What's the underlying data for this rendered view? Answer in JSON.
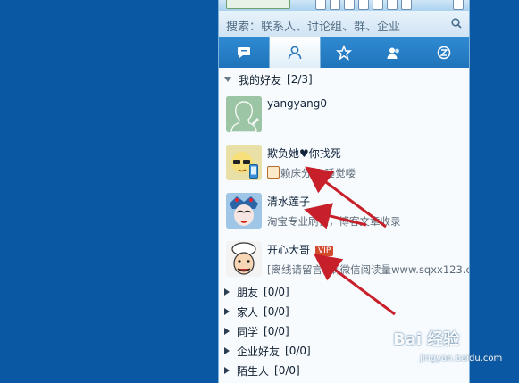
{
  "search": {
    "placeholder": "搜索：联系人、讨论组、群、企业"
  },
  "tabs": [
    {
      "name": "recent-chats",
      "icon": "chat-bubble-icon"
    },
    {
      "name": "contacts",
      "icon": "person-icon",
      "active": true
    },
    {
      "name": "favorites",
      "icon": "star-icon"
    },
    {
      "name": "groups",
      "icon": "group-icon"
    },
    {
      "name": "discover",
      "icon": "qzone-icon"
    }
  ],
  "groups": {
    "my_friends": {
      "label": "我的好友",
      "count": "[2/3]"
    },
    "friends": {
      "label": "朋友",
      "count": "[0/0]"
    },
    "family": {
      "label": "家人",
      "count": "[0/0]"
    },
    "classmates": {
      "label": "同学",
      "count": "[0/0]"
    },
    "enterprise": {
      "label": "企业好友",
      "count": "[0/0]"
    },
    "strangers": {
      "label": "陌生人",
      "count": "[0/0]"
    }
  },
  "contacts": [
    {
      "name": "yangyang0",
      "signature": ""
    },
    {
      "name": "欺负她♥你找死",
      "signature": "赖床分子 睡觉喽"
    },
    {
      "name": "清水莲子",
      "signature": "淘宝专业刷钻，博客文章收录"
    },
    {
      "name": "开心大哥",
      "badge": "VIP",
      "signature": "[离线请留言] 刷微信阅读量www.sqxx123.c"
    }
  ],
  "watermark": {
    "brand": "Bai 经验",
    "url": "jingyan.baidu.com"
  },
  "colors": {
    "desktop": "#0a57a3",
    "tab_bar": "#1f74bb",
    "arrow": "#c8202a"
  }
}
